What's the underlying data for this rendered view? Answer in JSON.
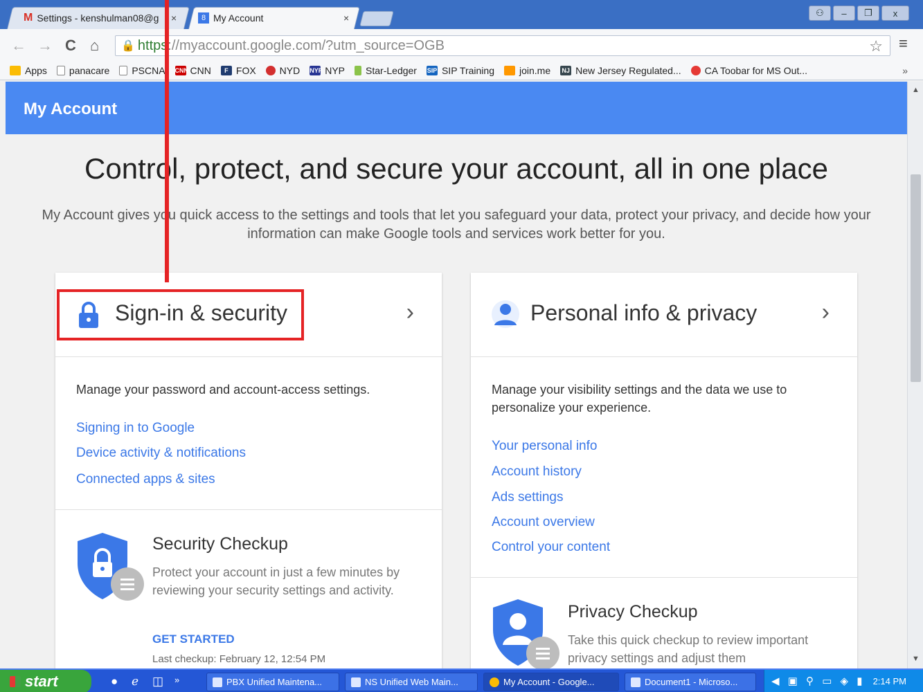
{
  "browser": {
    "tabs": [
      {
        "label": "Settings - kenshulman08@g",
        "icon": "gmail-icon"
      },
      {
        "label": "My Account",
        "icon": "google-icon"
      }
    ],
    "tab_close": "×",
    "window_buttons": {
      "user": "⚇",
      "minimize": "–",
      "restore": "❐",
      "close": "x"
    },
    "url_scheme": "https",
    "url_rest": "://myaccount.google.com/?utm_source=OGB",
    "bookmarks": [
      {
        "label": "Apps",
        "icon": "apps-grid-icon",
        "color": "#1a73e8"
      },
      {
        "label": "panacare",
        "icon": "page-icon",
        "color": "#ffffff"
      },
      {
        "label": "PSCNA",
        "icon": "page-icon",
        "color": "#ffffff"
      },
      {
        "label": "CNN",
        "icon": "cnn-icon",
        "color": "#cc0000"
      },
      {
        "label": "FOX",
        "icon": "fox-icon",
        "color": "#1f3b6f"
      },
      {
        "label": "NYD",
        "icon": "nyd-icon",
        "color": "#d32f2f"
      },
      {
        "label": "NYP",
        "icon": "nyp-icon",
        "color": "#283593"
      },
      {
        "label": "Star-Ledger",
        "icon": "starledger-icon",
        "color": "#8bc34a"
      },
      {
        "label": "SIP Training",
        "icon": "sip-icon",
        "color": "#1565c0"
      },
      {
        "label": "join.me",
        "icon": "joinme-icon",
        "color": "#ff9800"
      },
      {
        "label": "New Jersey Regulated...",
        "icon": "nj-icon",
        "color": "#37474f"
      },
      {
        "label": "CA Toobar for MS Out...",
        "icon": "ca-icon",
        "color": "#e53935"
      }
    ],
    "bookmarks_more": "»"
  },
  "page": {
    "appbar_title": "My Account",
    "hero": "Control, protect, and secure your account, all in one place",
    "lead": "My Account gives you quick access to the settings and tools that let you safeguard your data, protect your privacy, and decide how your information can make Google tools and services work better for you.",
    "cards": [
      {
        "title": "Sign-in & security",
        "desc": "Manage your password and account-access settings.",
        "links": [
          "Signing in to Google",
          "Device activity & notifications",
          "Connected apps & sites"
        ],
        "checkup_title": "Security Checkup",
        "checkup_text": "Protect your account in just a few minutes by reviewing your security settings and activity.",
        "checkup_cta": "GET STARTED",
        "checkup_meta": "Last checkup: February 12, 12:54 PM"
      },
      {
        "title": "Personal info & privacy",
        "desc": "Manage your visibility settings and the data we use to personalize your experience.",
        "links": [
          "Your personal info",
          "Account history",
          "Ads settings",
          "Account overview",
          "Control your content"
        ],
        "checkup_title": "Privacy Checkup",
        "checkup_text": "Take this quick checkup to review important privacy settings and adjust them"
      }
    ],
    "chevron": "›",
    "accent_color": "#4a89f2",
    "link_color": "#3b78e7",
    "annotation_color": "#e52325"
  },
  "taskbar": {
    "start_label": "start",
    "buttons": [
      {
        "label": "PBX Unified Maintena..."
      },
      {
        "label": "NS Unified Web Main..."
      },
      {
        "label": "My Account - Google..."
      },
      {
        "label": "Document1 - Microso..."
      }
    ],
    "clock": "2:14 PM"
  }
}
